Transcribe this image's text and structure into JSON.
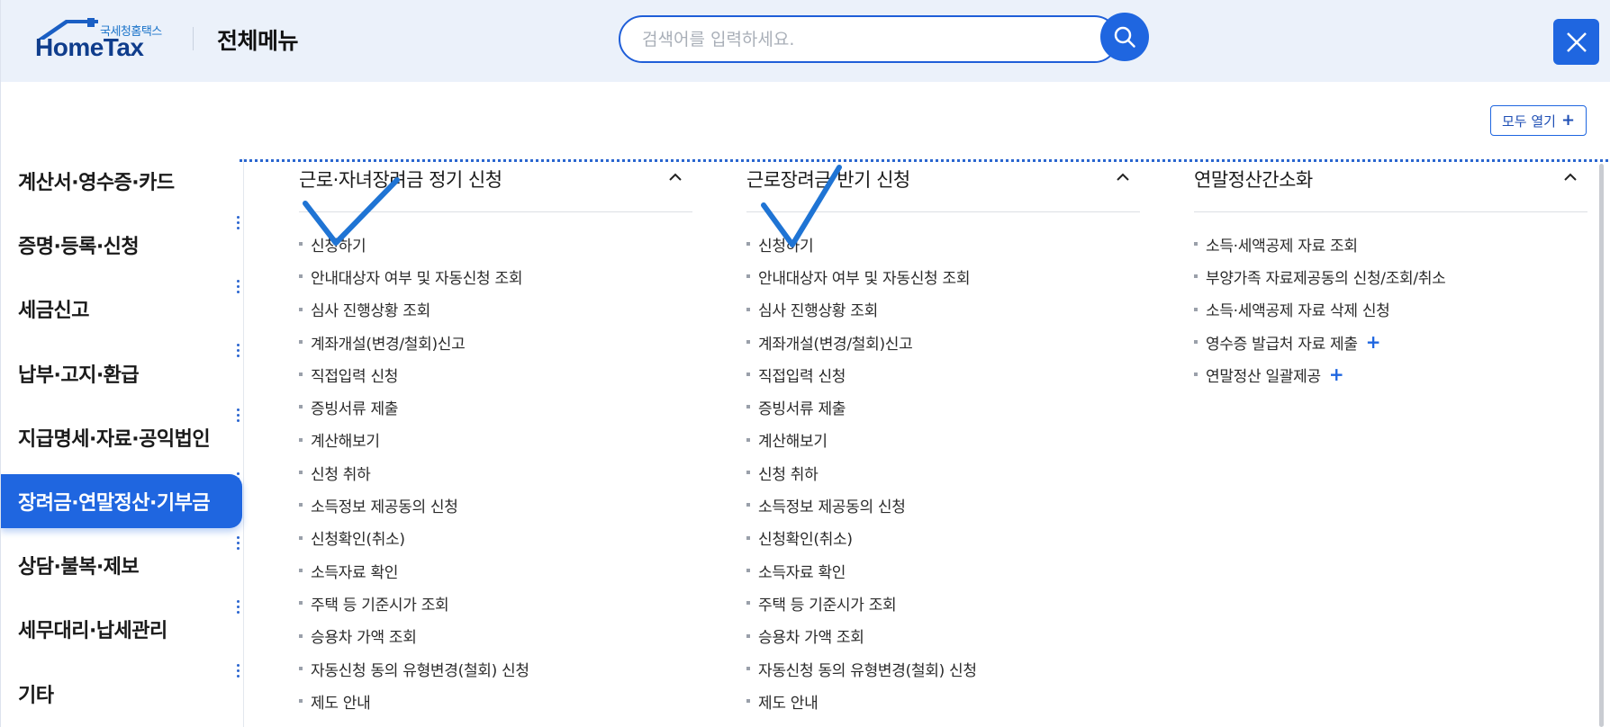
{
  "app": {
    "logo_small": "국세청홈택스",
    "logo_big": "HomeTax",
    "title": "전체메뉴"
  },
  "search": {
    "placeholder": "검색어를 입력하세요.",
    "value": ""
  },
  "expand_all": {
    "label": "모두 열기",
    "icon": "+"
  },
  "colors": {
    "accent": "#1f66e0",
    "header_bg": "#ebf1fa",
    "brand_dark": "#0f3d8c"
  },
  "sidebar": {
    "items": [
      {
        "label": "계산서·영수증·카드"
      },
      {
        "label": "증명·등록·신청"
      },
      {
        "label": "세금신고"
      },
      {
        "label": "납부·고지·환급"
      },
      {
        "label": "지급명세·자료·공익법인"
      },
      {
        "label": "장려금·연말정산·기부금",
        "active": true
      },
      {
        "label": "상담·불복·제보"
      },
      {
        "label": "세무대리·납세관리"
      },
      {
        "label": "기타"
      }
    ]
  },
  "columns": [
    {
      "title": "근로·자녀장려금 정기 신청",
      "toggle_icon": "chevron-up-icon",
      "items": [
        {
          "label": "신청하기"
        },
        {
          "label": "안내대상자 여부 및 자동신청 조회"
        },
        {
          "label": "심사 진행상황 조회"
        },
        {
          "label": "계좌개설(변경/철회)신고"
        },
        {
          "label": "직접입력 신청"
        },
        {
          "label": "증빙서류 제출"
        },
        {
          "label": "계산해보기"
        },
        {
          "label": "신청 취하"
        },
        {
          "label": "소득정보 제공동의 신청"
        },
        {
          "label": "신청확인(취소)"
        },
        {
          "label": "소득자료 확인"
        },
        {
          "label": "주택 등 기준시가 조회"
        },
        {
          "label": "승용차 가액 조회"
        },
        {
          "label": "자동신청 동의 유형변경(철회) 신청"
        },
        {
          "label": "제도 안내"
        }
      ]
    },
    {
      "title": "근로장려금 반기 신청",
      "toggle_icon": "chevron-up-icon",
      "items": [
        {
          "label": "신청하기"
        },
        {
          "label": "안내대상자 여부 및 자동신청 조회"
        },
        {
          "label": "심사 진행상황 조회"
        },
        {
          "label": "계좌개설(변경/철회)신고"
        },
        {
          "label": "직접입력 신청"
        },
        {
          "label": "증빙서류 제출"
        },
        {
          "label": "계산해보기"
        },
        {
          "label": "신청 취하"
        },
        {
          "label": "소득정보 제공동의 신청"
        },
        {
          "label": "신청확인(취소)"
        },
        {
          "label": "소득자료 확인"
        },
        {
          "label": "주택 등 기준시가 조회"
        },
        {
          "label": "승용차 가액 조회"
        },
        {
          "label": "자동신청 동의 유형변경(철회) 신청"
        },
        {
          "label": "제도 안내"
        }
      ]
    },
    {
      "title": "연말정산간소화",
      "toggle_icon": "chevron-up-icon",
      "items": [
        {
          "label": "소득·세액공제 자료 조회"
        },
        {
          "label": "부양가족 자료제공동의 신청/조회/취소"
        },
        {
          "label": "소득·세액공제 자료 삭제 신청"
        },
        {
          "label": "영수증 발급처 자료 제출",
          "plus": "+"
        },
        {
          "label": "연말정산 일괄제공",
          "plus": "+"
        }
      ]
    }
  ]
}
